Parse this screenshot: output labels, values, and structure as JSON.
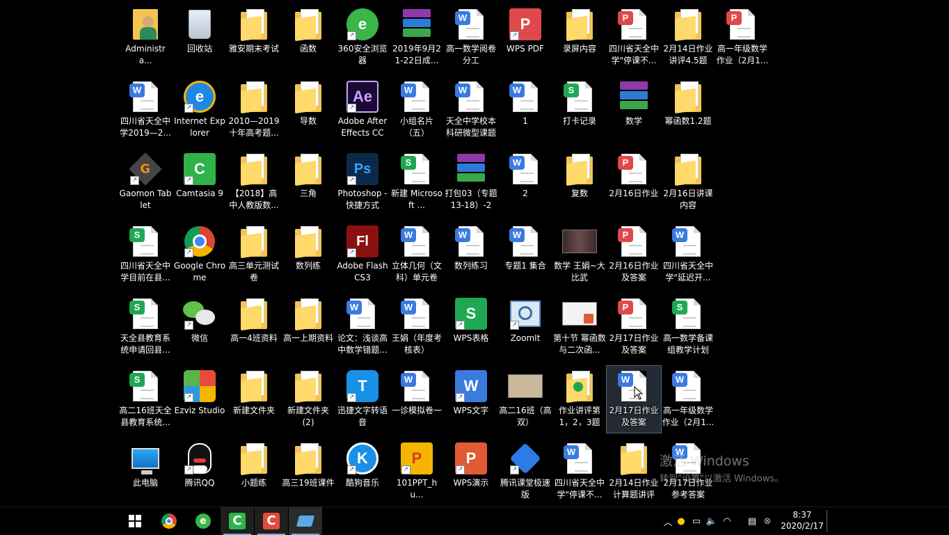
{
  "desktop": {
    "icons": [
      [
        "Administra...",
        "回收站",
        "雅安期末考试",
        "函数",
        "360安全浏览器",
        "2019年9月21-22日成...",
        "高一数学阅卷分工",
        "WPS PDF",
        "录屏内容",
        "四川省天全中学\"停课不...",
        "2月14日作业讲评4.5题",
        "高一年级数学作业（2月1..."
      ],
      [
        "四川省天全中学2019—2...",
        "Internet Explorer",
        "2010—2019十年高考题...",
        "导数",
        "Adobe After Effects CC ...",
        "小组名片（五）",
        "天全中学校本科研微型课题",
        "1",
        "打卡记录",
        "数学",
        "幂函数1.2题"
      ],
      [
        "Gaomon Tablet",
        "Camtasia 9",
        "【2018】高中人教版数...",
        "三角",
        "Photoshop - 快捷方式",
        "新建 Microsoft ...",
        "打包03（专题13-18）-20...",
        "2",
        "复数",
        "2月16日作业",
        "2月16日讲课内容"
      ],
      [
        "四川省天全中学目前在县...",
        "Google Chrome",
        "高三单元测试卷",
        "数列练",
        "Adobe Flash CS3",
        "立体几何（文科）单元卷",
        "数列练习",
        "专题1 集合",
        "数学 王娟~大比武",
        "2月16日作业及答案",
        "四川省天全中学\"延迟开..."
      ],
      [
        "天全县教育系统申请回县...",
        "微信",
        "高一4班资料",
        "高一上期资料",
        "论文：浅谈高中数学错题...",
        "王娟（年度考核表）",
        "WPS表格",
        "ZoomIt",
        "第十节 幂函数与二次函...",
        "2月17日作业及答案",
        "高一数学备课组教学计划"
      ],
      [
        "高二16班天全县教育系统...",
        "Ezviz Studio",
        "新建文件夹",
        "新建文件夹 (2)",
        "迅捷文字转语音",
        "一诊模拟卷一",
        "WPS文字",
        "高二16班（高双）",
        "作业讲评第1，2，3题",
        "2月17日作业及答案",
        "高一年级数学作业（2月1..."
      ],
      [
        "此电脑",
        "腾讯QQ",
        "小题练",
        "高三19班课件",
        "酷狗音乐",
        "101PPT_hu...",
        "WPS演示",
        "腾讯课堂极速版",
        "四川省天全中学\"停课不...",
        "2月14日作业计算题讲评",
        "2月17日作业参考答案"
      ]
    ],
    "icon_types": [
      [
        "user",
        "recycle",
        "folder-doc",
        "folder",
        "360",
        "rar",
        "w",
        "wpspdf",
        "folder",
        "p",
        "folder-doc",
        "p"
      ],
      [
        "w",
        "ie",
        "folder-doc",
        "folder-doc",
        "ae",
        "w",
        "w",
        "w",
        "s",
        "rar",
        "folder-doc"
      ],
      [
        "gaomon",
        "camtasia",
        "folder-doc",
        "folder",
        "ps",
        "s",
        "rar",
        "w",
        "folder",
        "p",
        "folder-doc"
      ],
      [
        "s",
        "chrome",
        "folder",
        "folder-doc",
        "fl",
        "w",
        "w",
        "w",
        "video",
        "p",
        "w"
      ],
      [
        "s",
        "wechat",
        "folder-doc",
        "folder",
        "w",
        "w",
        "wpss",
        "zoomit",
        "thumb-ppt",
        "p",
        "s"
      ],
      [
        "s",
        "ezviz",
        "folder",
        "folder-doc",
        "xunjie",
        "w",
        "wpsw",
        "thumb-img",
        "folder-s",
        "w",
        "w"
      ],
      [
        "pc",
        "qq",
        "folder-doc",
        "folder",
        "kugou",
        "101ppt",
        "wpsp",
        "tencentclass",
        "w",
        "folder-doc",
        "w"
      ]
    ],
    "selected": "2月17日作业及答案",
    "watermark": {
      "line1": "激活 Windows",
      "line2": "转到\"设置\"以激活 Windows。"
    }
  },
  "taskbar": {
    "apps": [
      "start-icon",
      "chrome-icon",
      "360-browser-icon",
      "camtasia-icon",
      "camtasia-recorder-icon",
      "gaomon-icon"
    ],
    "clock": {
      "time": "8:37",
      "date": "2020/2/17"
    },
    "colors": {
      "accent": "#6fa8dc",
      "wps_writer": "#3b7be0",
      "wps_pdf": "#e0494b",
      "wps_sheet": "#1fa854"
    }
  }
}
